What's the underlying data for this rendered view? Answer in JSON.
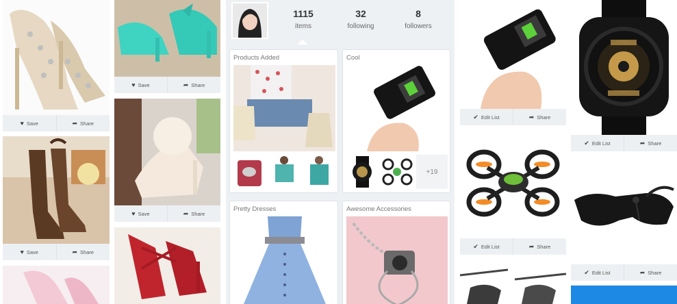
{
  "feed_left": {
    "actions": {
      "save_label": "Save",
      "share_label": "Share"
    }
  },
  "profile": {
    "stats": [
      {
        "value": "1115",
        "label": "items"
      },
      {
        "value": "32",
        "label": "following"
      },
      {
        "value": "8",
        "label": "followers"
      }
    ],
    "lists": [
      {
        "title": "Products Added"
      },
      {
        "title": "Cool",
        "more_count": "+19"
      },
      {
        "title": "Pretty Dresses"
      },
      {
        "title": "Awesome Accessories"
      }
    ]
  },
  "feed_right": {
    "actions": {
      "edit_label": "Edit List",
      "share_label": "Share"
    }
  },
  "icons": {
    "save": "heart-icon",
    "share": "share-arrow-icon",
    "edit": "checkmark-icon"
  },
  "colors": {
    "action_bar": "#edf0f3",
    "panel_bg": "#eef1f4",
    "tile_blue": "#1e88e5"
  }
}
